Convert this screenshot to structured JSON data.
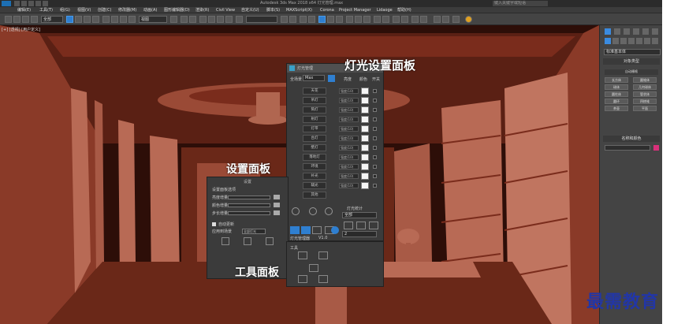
{
  "window": {
    "title": "Autodesk 3ds Max 2018 x64    灯光管理.max",
    "search_placeholder": "键入关键字或短语"
  },
  "menu": {
    "items": [
      "编辑(E)",
      "工具(T)",
      "组(G)",
      "视图(V)",
      "创建(C)",
      "修改器(M)",
      "动画(A)",
      "图形编辑器(D)",
      "渲染(R)",
      "Civil View",
      "自定义(U)",
      "脚本(S)",
      "MAXScript(X)",
      "Corona",
      "Project Manager",
      "Lidaoge",
      "帮助(H)"
    ]
  },
  "toolbar": {
    "filter_select": "全部",
    "view_select": "视图"
  },
  "viewport": {
    "label": "[+] [透视] [用户定义]"
  },
  "command_panel": {
    "dropdown": "标准基本体",
    "object_type_title": "对象类型",
    "auto_grid": "自动栅格",
    "objects": [
      "长方体",
      "圆锥体",
      "球体",
      "几何球体",
      "圆柱体",
      "管状体",
      "圆环",
      "四棱锥",
      "茶壶",
      "平面"
    ],
    "name_color_title": "名称和颜色",
    "accent_color": "#d8307a"
  },
  "light_panel": {
    "header": "灯光管理",
    "scene_label": "全场景",
    "scene_value": "Max",
    "light_buttons": [
      "天花",
      "吊灯",
      "筒灯",
      "射灯",
      "灯带",
      "台灯",
      "壁灯",
      "落地灯",
      "环境",
      "补光",
      "辅光",
      "其他"
    ],
    "col_intensity": "亮度",
    "col_color": "颜色",
    "col_toggle": "开关",
    "prop_value": "强度(10)",
    "section_label": "灯光统计",
    "section_select": "全部",
    "section_input": "2",
    "footer_left": "灯光管理器",
    "footer_right": "V1.0"
  },
  "settings_panel": {
    "mini_title": "设置",
    "section": "设置面板选项",
    "rows": [
      "亮度增量",
      "颜色增量",
      "步长增量"
    ],
    "auto_label": "自动更新",
    "apply_label": "应用到场景",
    "apply_select": "全部灯光"
  },
  "tools_panel": {
    "title": "工具"
  },
  "annotations": {
    "light": "灯光设置面板",
    "settings": "设置面板",
    "tools": "工具面板"
  },
  "watermark": "最需教育"
}
